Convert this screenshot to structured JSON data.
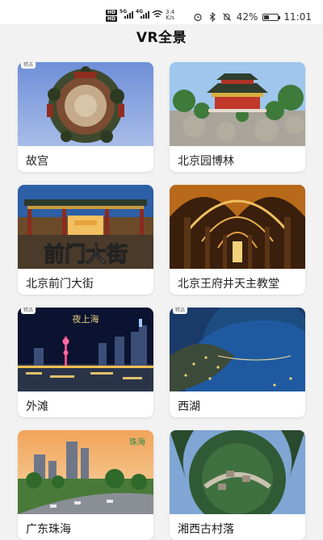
{
  "status_bar": {
    "hd_top": "HD",
    "hd_bottom": "HD",
    "sig1_label": "5G",
    "sig2_label": "4G",
    "net_speed_value": "3.4",
    "net_speed_unit": "K/s",
    "battery_percent": "42%",
    "battery_level": 0.42,
    "time": "11:01",
    "icons": [
      "alarm-icon",
      "bluetooth-icon",
      "mute-icon",
      "battery-icon"
    ]
  },
  "header": {
    "title": "VR全景"
  },
  "cards": [
    {
      "label": "故宫",
      "badge": "精选"
    },
    {
      "label": "北京园博林",
      "badge": ""
    },
    {
      "label": "北京前门大街",
      "badge": "",
      "overlay": "前门大街"
    },
    {
      "label": "北京王府井天主教堂",
      "badge": ""
    },
    {
      "label": "外滩",
      "badge": "精选",
      "overlay": "夜上海"
    },
    {
      "label": "西湖",
      "badge": "精选"
    },
    {
      "label": "广东珠海",
      "badge": "",
      "overlay": "珠海"
    },
    {
      "label": "湘西古村落",
      "badge": ""
    }
  ]
}
